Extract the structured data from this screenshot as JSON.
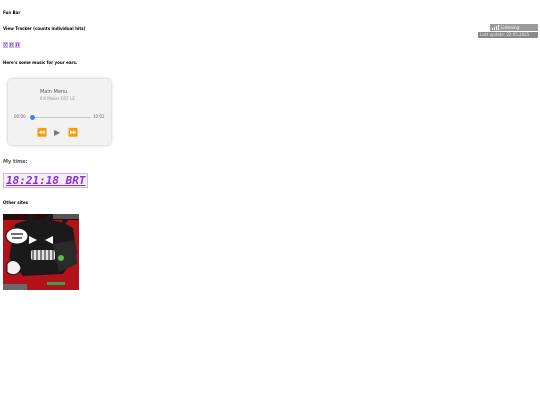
{
  "header": {
    "title": "Fun Bar"
  },
  "tracker": {
    "label": "View Tracker (counts individual hits)",
    "digits": [
      "0",
      "2",
      "1"
    ]
  },
  "music": {
    "intro": "Here's some music for your ears.",
    "title": "Main Menu",
    "artist": "Kill Maker OST LE",
    "current_time": "00:00",
    "duration": "10:02",
    "progress": 0.0,
    "accent": "#3b82f6"
  },
  "my_time": {
    "label": "My time:",
    "clock": "18:21:18 BRT",
    "color": "#8a2be2"
  },
  "other_sites": {
    "label": "Other sites"
  },
  "badges": {
    "badge1": "Listening",
    "badge2": "Last update: 22.05.2025"
  }
}
